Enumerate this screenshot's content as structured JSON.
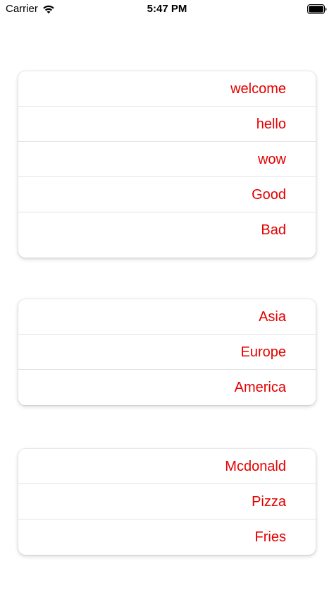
{
  "status_bar": {
    "carrier": "Carrier",
    "time": "5:47 PM",
    "wifi_icon": "wifi-icon",
    "battery_icon": "battery-icon"
  },
  "colors": {
    "item_text": "#e30000",
    "separator": "#e4e4e6",
    "background": "#ffffff"
  },
  "sections": [
    {
      "items": [
        {
          "label": "welcome"
        },
        {
          "label": "hello"
        },
        {
          "label": "wow"
        },
        {
          "label": "Good"
        },
        {
          "label": "Bad"
        }
      ]
    },
    {
      "items": [
        {
          "label": "Asia"
        },
        {
          "label": "Europe"
        },
        {
          "label": "America"
        }
      ]
    },
    {
      "items": [
        {
          "label": "Mcdonald"
        },
        {
          "label": "Pizza"
        },
        {
          "label": "Fries"
        }
      ]
    }
  ]
}
